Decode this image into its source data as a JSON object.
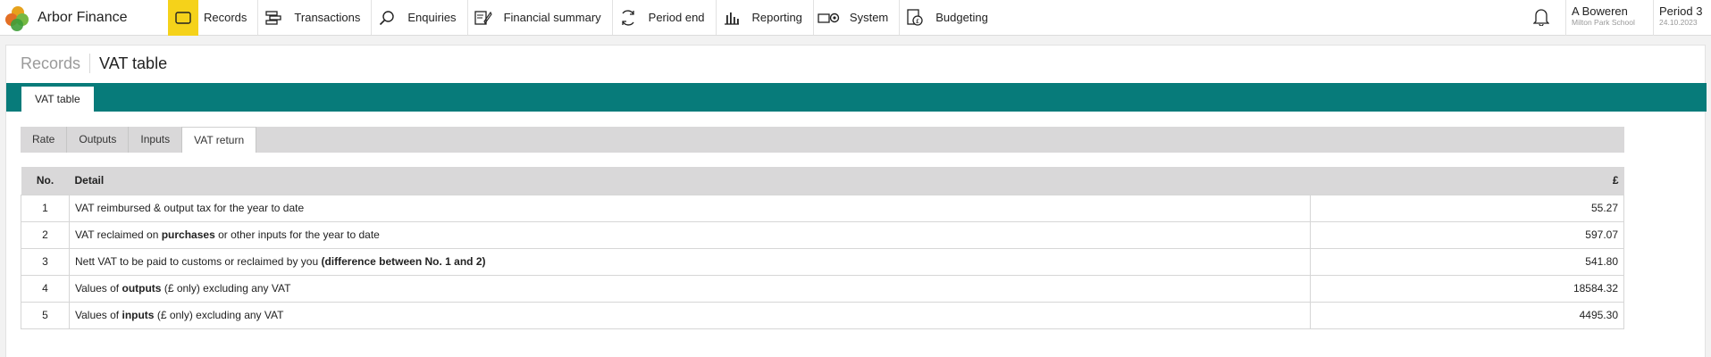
{
  "brand": {
    "name": "Arbor Finance"
  },
  "nav": [
    {
      "label": "Records",
      "icon": "records-icon",
      "active": true
    },
    {
      "label": "Transactions",
      "icon": "transactions-icon"
    },
    {
      "label": "Enquiries",
      "icon": "search-icon"
    },
    {
      "label": "Financial summary",
      "icon": "financial-summary-icon"
    },
    {
      "label": "Period end",
      "icon": "refresh-icon"
    },
    {
      "label": "Reporting",
      "icon": "bar-chart-icon"
    },
    {
      "label": "System",
      "icon": "system-icon"
    },
    {
      "label": "Budgeting",
      "icon": "budget-icon"
    }
  ],
  "user": {
    "name": "A Boweren",
    "school": "Milton Park School"
  },
  "period": {
    "label": "Period 3",
    "date": "24.10.2023"
  },
  "breadcrumb": {
    "parent": "Records",
    "current": "VAT table"
  },
  "page_tab": "VAT table",
  "subtabs": [
    "Rate",
    "Outputs",
    "Inputs",
    "VAT return"
  ],
  "active_subtab": "VAT return",
  "table": {
    "headers": {
      "no": "No.",
      "detail": "Detail",
      "amount": "£"
    },
    "rows": [
      {
        "no": "1",
        "detail": [
          [
            "VAT reimbursed & output tax for the year to date",
            false
          ]
        ],
        "amount": "55.27"
      },
      {
        "no": "2",
        "detail": [
          [
            "VAT reclaimed on ",
            false
          ],
          [
            "purchases",
            true
          ],
          [
            " or other inputs for the year to date",
            false
          ]
        ],
        "amount": "597.07"
      },
      {
        "no": "3",
        "detail": [
          [
            "Nett VAT to be paid to customs or reclaimed by you ",
            false
          ],
          [
            "(difference between No. 1 and 2)",
            true
          ]
        ],
        "amount": "541.80"
      },
      {
        "no": "4",
        "detail": [
          [
            "Values of ",
            false
          ],
          [
            "outputs",
            true
          ],
          [
            " (£ only) excluding any VAT",
            false
          ]
        ],
        "amount": "18584.32"
      },
      {
        "no": "5",
        "detail": [
          [
            "Values of ",
            false
          ],
          [
            "inputs",
            true
          ],
          [
            " (£ only) excluding any VAT",
            false
          ]
        ],
        "amount": "4495.30"
      }
    ]
  },
  "colors": {
    "teal": "#077b7a",
    "active_nav": "#f5d21a",
    "header_grey": "#d9d8d9"
  }
}
